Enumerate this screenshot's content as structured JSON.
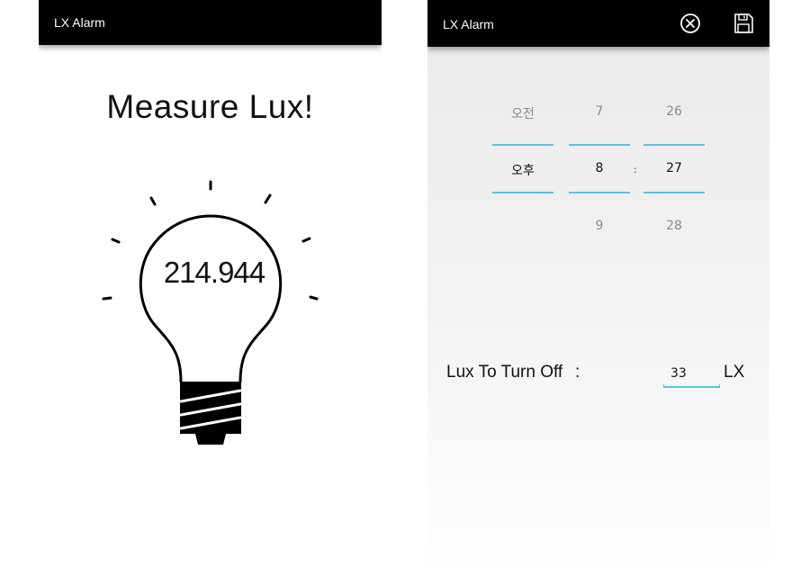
{
  "left_screen": {
    "app_title": "LX Alarm",
    "headline": "Measure Lux!",
    "lux_reading": "214.944"
  },
  "right_screen": {
    "app_title": "LX Alarm",
    "icons": {
      "cancel": "circle-x-icon",
      "save": "floppy-disk-icon"
    },
    "time_picker": {
      "ampm": {
        "above": "오전",
        "selected": "오후",
        "below": ""
      },
      "hour": {
        "above": "7",
        "selected": "8",
        "below": "9"
      },
      "separator": ":",
      "minute": {
        "above": "26",
        "selected": "27",
        "below": "28"
      }
    },
    "lux_off": {
      "label": "Lux To Turn Off",
      "colon": ":",
      "value": "33",
      "unit": "LX"
    }
  },
  "colors": {
    "appbar": "#000000",
    "accent": "#5bc0de"
  }
}
